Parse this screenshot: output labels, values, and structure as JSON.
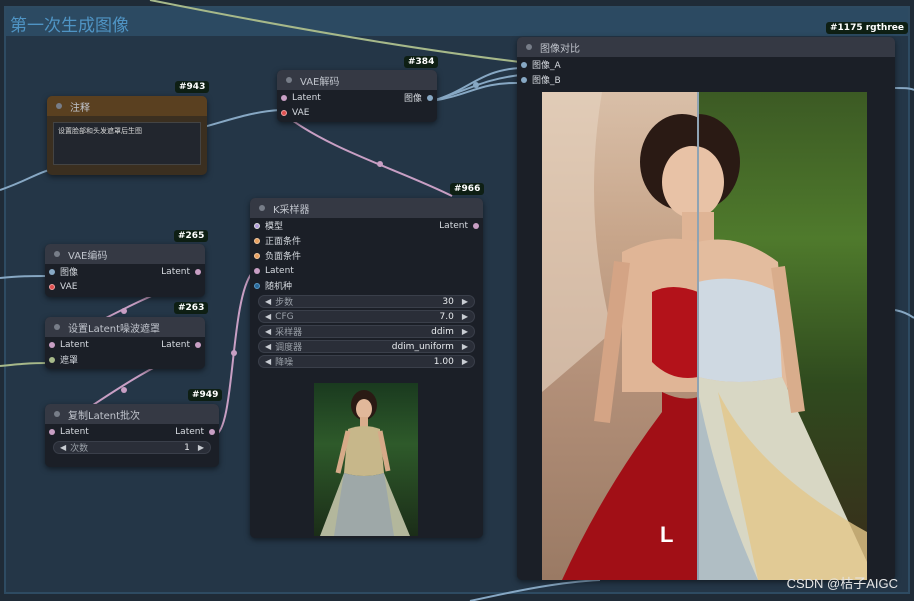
{
  "group": {
    "title": "第一次生成图像"
  },
  "badges": {
    "compare": "#1175 rgthree",
    "note": "#943",
    "vae_decode": "#384",
    "ksampler": "#966",
    "vae_encode": "#265",
    "set_latent_mask": "#263",
    "repeat_latent": "#949"
  },
  "note_node": {
    "title": "注释",
    "text": "设置脸部和头发遮罩后生图"
  },
  "vae_decode": {
    "title": "VAE解码",
    "inputs": [
      "Latent",
      "VAE"
    ],
    "output": "图像"
  },
  "vae_encode": {
    "title": "VAE编码",
    "inputs": [
      "图像",
      "VAE"
    ],
    "output": "Latent"
  },
  "set_latent_mask": {
    "title": "设置Latent噪波遮罩",
    "inputs": [
      "Latent",
      "遮罩"
    ],
    "output": "Latent"
  },
  "repeat_latent": {
    "title": "复制Latent批次",
    "inputs": [
      "Latent"
    ],
    "output": "Latent",
    "widget": {
      "label": "次数",
      "value": "1"
    }
  },
  "ksampler": {
    "title": "K采样器",
    "inputs": [
      "模型",
      "正面条件",
      "负面条件",
      "Latent",
      "随机种"
    ],
    "output": "Latent",
    "widgets": [
      {
        "label": "步数",
        "value": "30"
      },
      {
        "label": "CFG",
        "value": "7.0"
      },
      {
        "label": "采样器",
        "value": "ddim"
      },
      {
        "label": "调度器",
        "value": "ddim_uniform"
      },
      {
        "label": "降噪",
        "value": "1.00"
      }
    ]
  },
  "compare_node": {
    "title": "图像对比",
    "inputs": [
      "图像_A",
      "图像_B"
    ]
  },
  "watermark": "CSDN @桔子AIGC",
  "photo_mark": "L"
}
